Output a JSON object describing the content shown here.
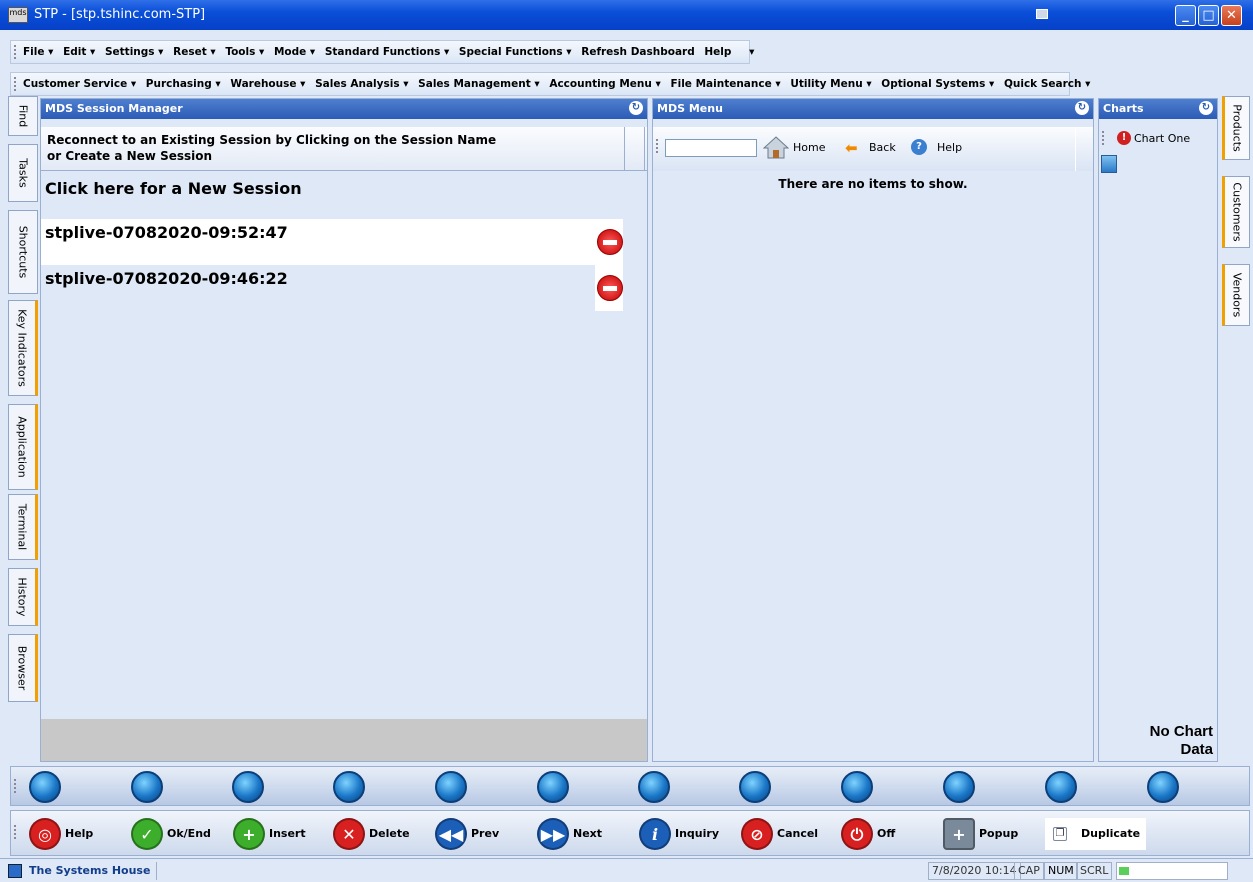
{
  "window": {
    "title": "STP - [stp.tshinc.com-STP]",
    "logo_text": "mds"
  },
  "menubar1": [
    "File ▾",
    "Edit ▾",
    "Settings ▾",
    "Reset ▾",
    "Tools ▾",
    "Mode ▾",
    "Standard Functions ▾",
    "Special Functions ▾",
    "Refresh Dashboard",
    "Help",
    "▾"
  ],
  "menubar2": [
    "Customer Service ▾",
    "Purchasing ▾",
    "Warehouse ▾",
    "Sales Analysis ▾",
    "Sales Management ▾",
    "Accounting Menu ▾",
    "File Maintenance ▾",
    "Utility Menu ▾",
    "Optional Systems ▾",
    "Quick Search ▾"
  ],
  "left_tabs": [
    "Find",
    "Tasks",
    "Shortcuts",
    "Key Indicators",
    "Application",
    "Terminal",
    "History",
    "Browser"
  ],
  "right_tabs": [
    "Products",
    "Customers",
    "Vendors"
  ],
  "session_panel": {
    "title": "MDS Session Manager",
    "header_line1": "Reconnect to an Existing Session by Clicking on the Session Name",
    "header_line2": "or Create a  New Session",
    "new_session": "Click here for a New Session",
    "sessions": [
      "stplive-07082020-09:52:47",
      "stplive-07082020-09:46:22"
    ]
  },
  "menu_panel": {
    "title": "MDS Menu",
    "home": "Home",
    "back": "Back",
    "help": "Help",
    "empty": "There are no items to show.",
    "search_value": ""
  },
  "charts_panel": {
    "title": "Charts",
    "chart_item": "Chart One",
    "no_data_1": "No Chart",
    "no_data_2": "Data"
  },
  "actions": [
    "Help",
    "Ok/End",
    "Insert",
    "Delete",
    "Prev",
    "Next",
    "Inquiry",
    "Cancel",
    "Off",
    "Popup",
    "Duplicate"
  ],
  "action_colors": [
    "#d92020",
    "#3cae2c",
    "#3cae2c",
    "#d92020",
    "#1c5fb8",
    "#1c5fb8",
    "#1c5fb8",
    "#d92020",
    "#d92020",
    "#7a8a9a",
    "#ffffff"
  ],
  "status": {
    "company": "The Systems House",
    "datetime": "7/8/2020 10:14",
    "cap": "CAP",
    "num": "NUM",
    "scrl": "SCRL"
  }
}
